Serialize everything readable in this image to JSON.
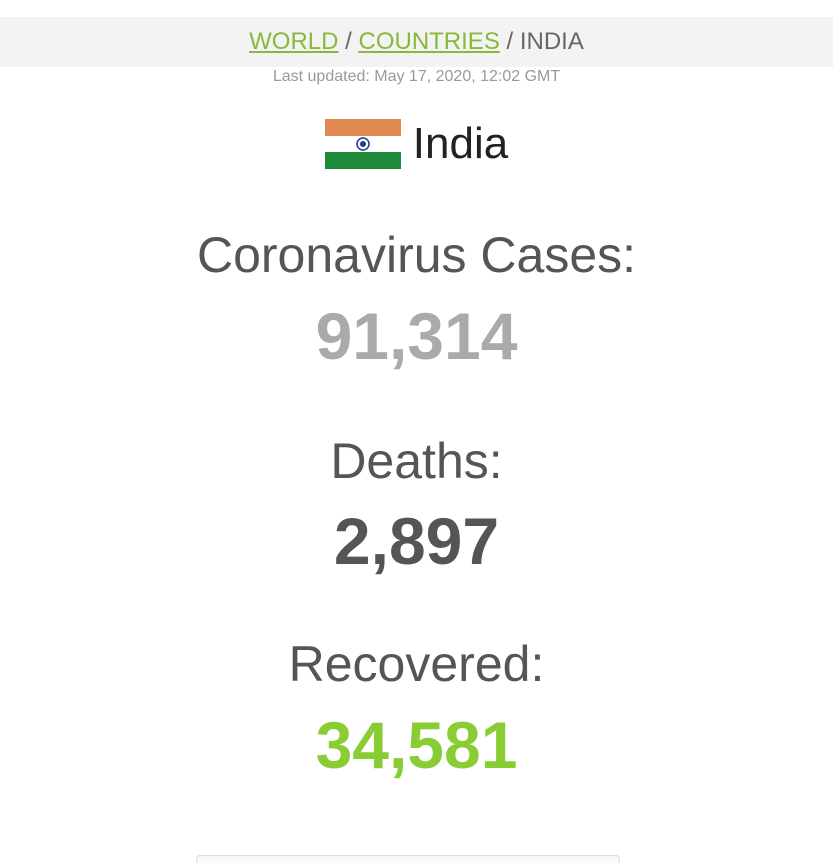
{
  "breadcrumb": {
    "world": "WORLD",
    "countries": "COUNTRIES",
    "current": "INDIA",
    "separator": "/"
  },
  "last_updated": "Last updated: May 17, 2020, 12:02 GMT",
  "country": {
    "name": "India",
    "flag_icon": "india-flag-icon"
  },
  "stats": {
    "cases": {
      "label": "Coronavirus Cases:",
      "value": "91,314"
    },
    "deaths": {
      "label": "Deaths:",
      "value": "2,897"
    },
    "recovered": {
      "label": "Recovered:",
      "value": "34,581"
    }
  },
  "colors": {
    "link": "#8ab83c",
    "cases_value": "#aaaaaa",
    "deaths_value": "#555555",
    "recovered_value": "#8acc34",
    "flag_saffron": "#e08a52",
    "flag_green": "#1f8a3c",
    "flag_chakra": "#1a3c8a"
  }
}
